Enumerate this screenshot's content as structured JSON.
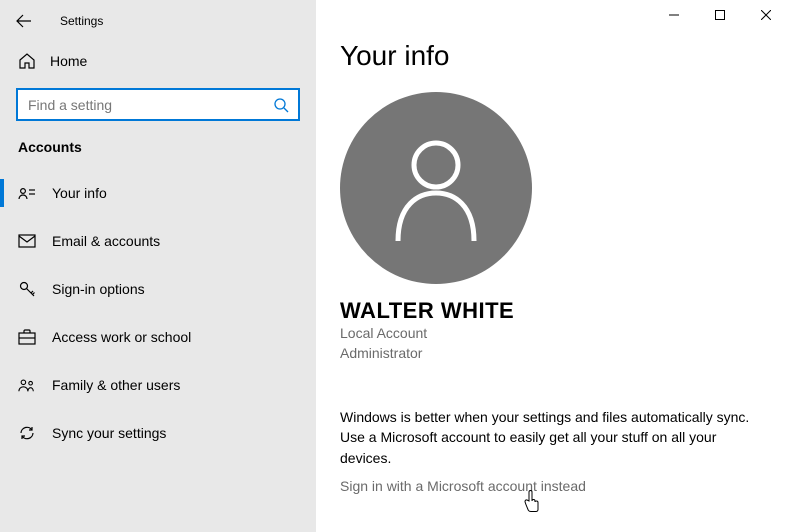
{
  "window": {
    "title": "Settings"
  },
  "sidebar": {
    "home_label": "Home",
    "search_placeholder": "Find a setting",
    "section": "Accounts",
    "items": [
      {
        "label": "Your info"
      },
      {
        "label": "Email & accounts"
      },
      {
        "label": "Sign-in options"
      },
      {
        "label": "Access work or school"
      },
      {
        "label": "Family & other users"
      },
      {
        "label": "Sync your settings"
      }
    ]
  },
  "main": {
    "page_title": "Your info",
    "user_name": "WALTER WHITE",
    "account_type": "Local Account",
    "role": "Administrator",
    "promo_line1": "Windows is better when your settings and files automatically sync.",
    "promo_line2": "Use a Microsoft account to easily get all your stuff on all your devices.",
    "signin_link": "Sign in with a Microsoft account instead"
  }
}
